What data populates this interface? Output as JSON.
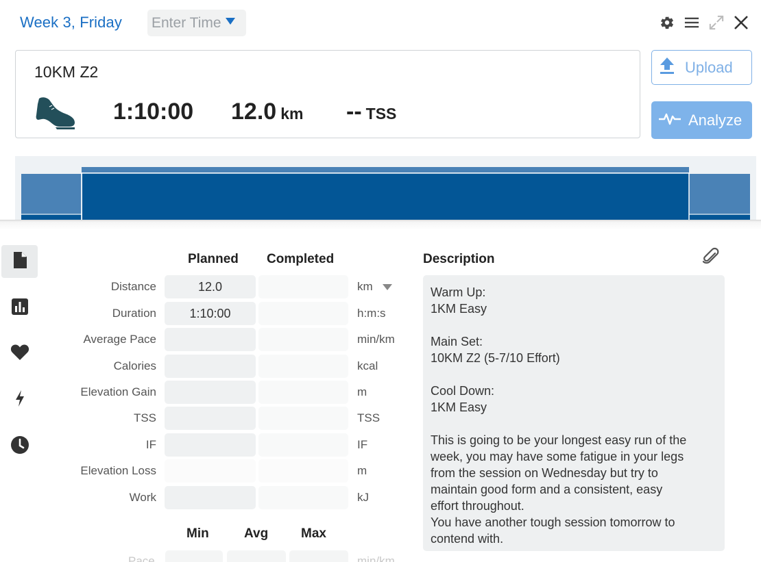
{
  "header": {
    "day_title": "Week 3, Friday",
    "time_placeholder": "Enter Time"
  },
  "toolbar_icons": [
    "gear-icon",
    "menu-icon",
    "expand-icon",
    "close-icon"
  ],
  "workout": {
    "title": "10KM Z2",
    "sport_icon": "running-shoe-icon",
    "duration": "1:10:00",
    "distance_value": "12.0",
    "distance_unit": "km",
    "tss_value": "--",
    "tss_unit": "TSS"
  },
  "actions": {
    "upload_label": "Upload",
    "analyze_label": "Analyze"
  },
  "graph_colors": {
    "main_block": "#035696",
    "warm_cool_block": "#4a82b6",
    "background": "#eef2f5"
  },
  "nav": [
    {
      "name": "summary",
      "icon": "document-icon",
      "active": true
    },
    {
      "name": "charts",
      "icon": "bar-chart-icon",
      "active": false
    },
    {
      "name": "health",
      "icon": "heart-icon",
      "active": false
    },
    {
      "name": "power",
      "icon": "lightning-icon",
      "active": false
    },
    {
      "name": "history",
      "icon": "clock-icon",
      "active": false
    }
  ],
  "metrics": {
    "planned_header": "Planned",
    "completed_header": "Completed",
    "rows": [
      {
        "label": "Distance",
        "planned": "12.0",
        "completed": "",
        "unit": "km"
      },
      {
        "label": "Duration",
        "planned": "1:10:00",
        "completed": "",
        "unit": "h:m:s"
      },
      {
        "label": "Average Pace",
        "planned": "",
        "completed": "",
        "unit": "min/km"
      },
      {
        "label": "Calories",
        "planned": "",
        "completed": "",
        "unit": "kcal"
      },
      {
        "label": "Elevation Gain",
        "planned": "",
        "completed": "",
        "unit": "m"
      },
      {
        "label": "TSS",
        "planned": "",
        "completed": "",
        "unit": "TSS"
      },
      {
        "label": "IF",
        "planned": "",
        "completed": "",
        "unit": "IF"
      },
      {
        "label": "Elevation Loss",
        "planned": "",
        "completed": "",
        "unit": "m"
      },
      {
        "label": "Work",
        "planned": "",
        "completed": "",
        "unit": "kJ"
      }
    ],
    "range_headers": [
      "Min",
      "Avg",
      "Max"
    ],
    "pace_label": "Pace",
    "pace_unit": "min/km"
  },
  "description": {
    "header": "Description",
    "text": "Warm Up:\n1KM Easy\n\nMain Set:\n10KM Z2 (5-7/10 Effort)\n\nCool Down:\n1KM Easy\n\nThis is going to be your longest easy run of the\nweek, you may have some fatigue in your legs\nfrom the session on Wednesday but try to\nmaintain good form and a consistent, easy\neffort throughout.\nYou have another tough session tomorrow to\ncontend with."
  }
}
